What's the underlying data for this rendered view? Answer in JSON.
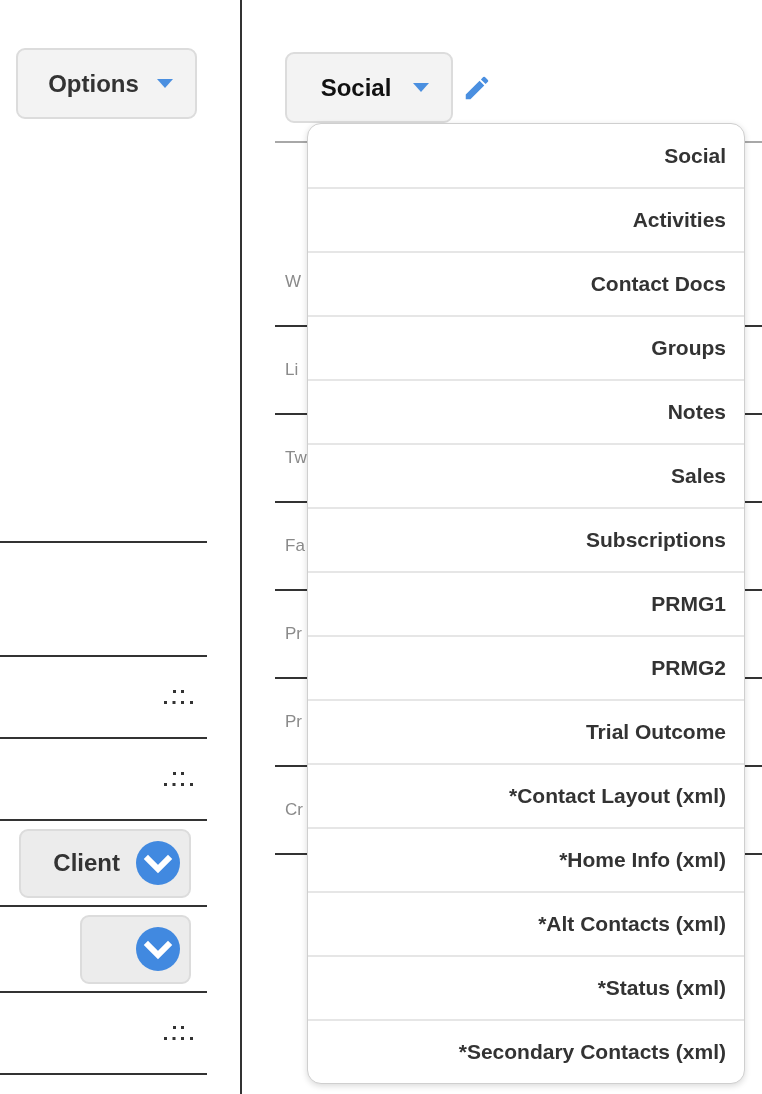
{
  "left_panel": {
    "options_button": {
      "label": "Options"
    },
    "rows": [
      {
        "kind": "blank"
      },
      {
        "kind": "grip"
      },
      {
        "kind": "grip"
      },
      {
        "kind": "select",
        "value": "Client"
      },
      {
        "kind": "select"
      },
      {
        "kind": "grip"
      }
    ]
  },
  "right_panel": {
    "view_select": {
      "value": "Social"
    },
    "fields": [
      {
        "label": "W"
      },
      {
        "label": "Li"
      },
      {
        "label": "Tw"
      },
      {
        "label": "Fa"
      },
      {
        "label": "Pr"
      },
      {
        "label": "Pr"
      },
      {
        "label": "Cr"
      }
    ],
    "view_menu": {
      "items": [
        {
          "label": "Social"
        },
        {
          "label": "Activities"
        },
        {
          "label": "Contact Docs"
        },
        {
          "label": "Groups"
        },
        {
          "label": "Notes"
        },
        {
          "label": "Sales"
        },
        {
          "label": "Subscriptions"
        },
        {
          "label": "PRMG1"
        },
        {
          "label": "PRMG2"
        },
        {
          "label": "Trial Outcome"
        },
        {
          "label": "*Contact Layout (xml)"
        },
        {
          "label": "*Home Info (xml)"
        },
        {
          "label": "*Alt Contacts (xml)"
        },
        {
          "label": "*Status (xml)"
        },
        {
          "label": "*Secondary Contacts (xml)"
        }
      ]
    }
  }
}
